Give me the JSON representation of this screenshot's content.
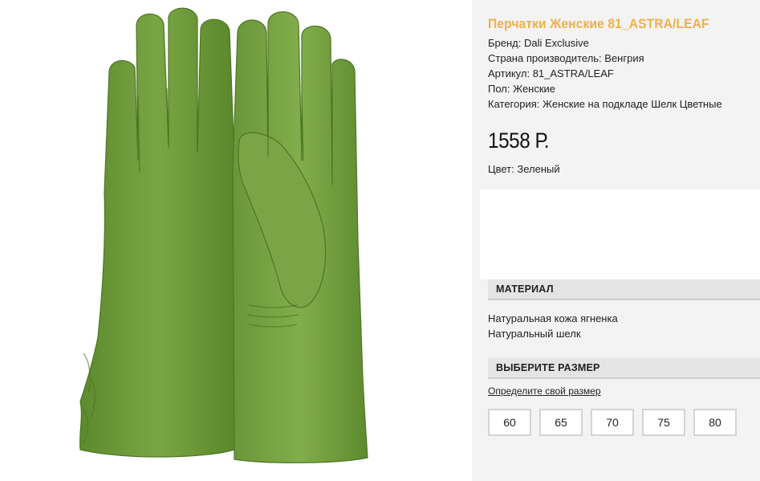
{
  "product": {
    "title": "Перчатки Женские 81_ASTRA/LEAF",
    "brand": "Бренд: Dali Exclusive",
    "country": "Страна производитель: Венгрия",
    "article": "Артикул: 81_ASTRA/LEAF",
    "gender": "Пол: Женские",
    "category": "Категория: Женские на подкладе Шелк Цветные",
    "price": "1558 Р.",
    "color": "Цвет: Зеленый"
  },
  "material": {
    "header": "МАТЕРИАЛ",
    "items": [
      "Натуральная кожа ягненка",
      "Натуральный шелк"
    ]
  },
  "size": {
    "header": "ВЫБЕРИТЕ РАЗМЕР",
    "link": "Определите свой размер",
    "options": [
      "60",
      "65",
      "70",
      "75",
      "80"
    ]
  },
  "colors": {
    "title": "#f0b04a",
    "glove": "#6f9a3c",
    "panel": "#f3f3f3"
  },
  "image": {
    "icon": "green-leather-gloves-photo"
  }
}
